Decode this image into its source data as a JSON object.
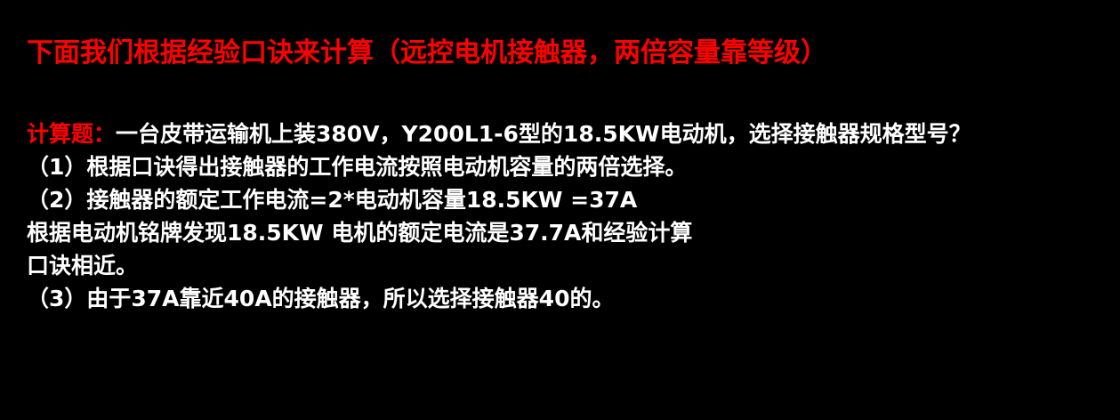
{
  "colors": {
    "background": "#000000",
    "title": "#ff0000",
    "label": "#ff0000",
    "text": "#ffffff"
  },
  "slide": {
    "title": "下面我们根据经验口诀来计算（远控电机接触器，两倍容量靠等级）",
    "question_label": "计算题：",
    "question_text": "一台皮带运输机上装380V，Y200L1-6型的18.5KW电动机，选择接触器规格型号？",
    "steps": [
      "（1）根据口诀得出接触器的工作电流按照电动机容量的两倍选择。",
      "（2）接触器的额定工作电流=2*电动机容量18.5KW =37A",
      "根据电动机铭牌发现18.5KW 电机的额定电流是37.7A和经验计算",
      "口诀相近。",
      "（3）由于37A靠近40A的接触器，所以选择接触器40的。"
    ]
  }
}
